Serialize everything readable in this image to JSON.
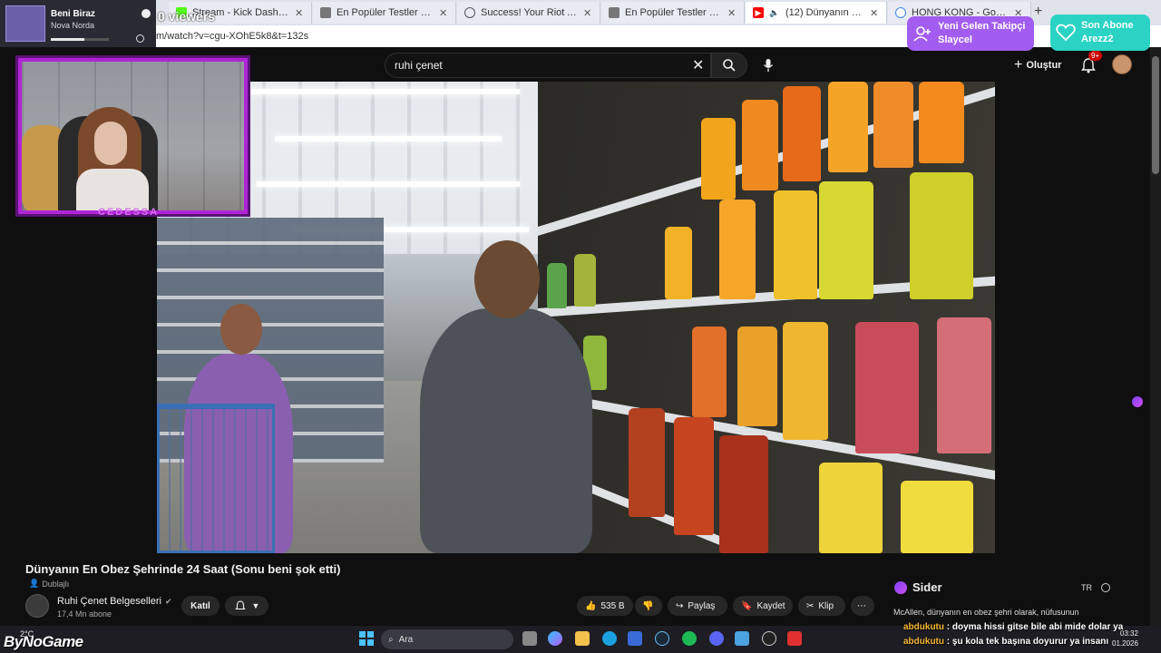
{
  "browser": {
    "tabs": [
      {
        "title": "Stream - Kick Dashboard",
        "favicon": "kick-icon",
        "active": false
      },
      {
        "title": "En Popüler Testler ve Eğlenceli Qu",
        "favicon": "page-icon",
        "active": false
      },
      {
        "title": "Success! Your Riot Account is now",
        "favicon": "globe-icon",
        "active": false
      },
      {
        "title": "En Popüler Testler ve Eğlenceli Qu",
        "favicon": "page-icon",
        "active": false
      },
      {
        "title": "(12) Dünyanın En Obez Şehrin",
        "favicon": "youtube-icon",
        "active": true
      },
      {
        "title": "HONG KONG - Google'da Ara",
        "favicon": "google-icon",
        "active": false
      }
    ],
    "url": "m/watch?v=cgu-XOhE5k8&t=132s"
  },
  "youtube": {
    "search_query": "ruhi çenet",
    "create_label": "Oluştur",
    "notification_count": "9+",
    "video": {
      "title": "Dünyanın En Obez Şehrinde 24 Saat (Sonu beni şok etti)",
      "dubbed_label": "Dublajlı",
      "channel_name": "Ruhi Çenet Belgeselleri",
      "subscribers": "17,4 Mn abone",
      "join_label": "Katıl",
      "like_count": "535 B",
      "share_label": "Paylaş",
      "save_label": "Kaydet",
      "clip_label": "Klip"
    }
  },
  "stream_overlay": {
    "kick_widget": {
      "title": "Beni Biraz",
      "subtitle": "Nova Norda",
      "progress": 0.58
    },
    "viewers": "0 viewers",
    "webcam_label": "CEDESSA",
    "alert_follower": {
      "line1": "Yeni Gelen Takipçi",
      "line2": "Slaycel"
    },
    "alert_subscriber": {
      "line1": "Son Abone",
      "line2": "Arezz2"
    },
    "chat": [
      {
        "user": "abdukutu",
        "message": ": doyma hissi gitse bile abi mide dolar ya"
      },
      {
        "user": "abdukutu",
        "message": ": şu kola tek başına doyurur ya insanı"
      }
    ],
    "logo": "ByNoGame"
  },
  "sider": {
    "name": "Sider",
    "lang": "TR",
    "summary": "McAllen, dünyanın en obez şehri olarak, nüfusunun"
  },
  "taskbar": {
    "weather": "2°C",
    "search_placeholder": "Ara",
    "time": "03:32",
    "date": "01.2026"
  },
  "colors": {
    "accent_purple": "#a35cf0",
    "accent_teal": "#2ad3c4",
    "webcam_border": "#b025d6",
    "youtube_bg": "#0f0f0f"
  }
}
